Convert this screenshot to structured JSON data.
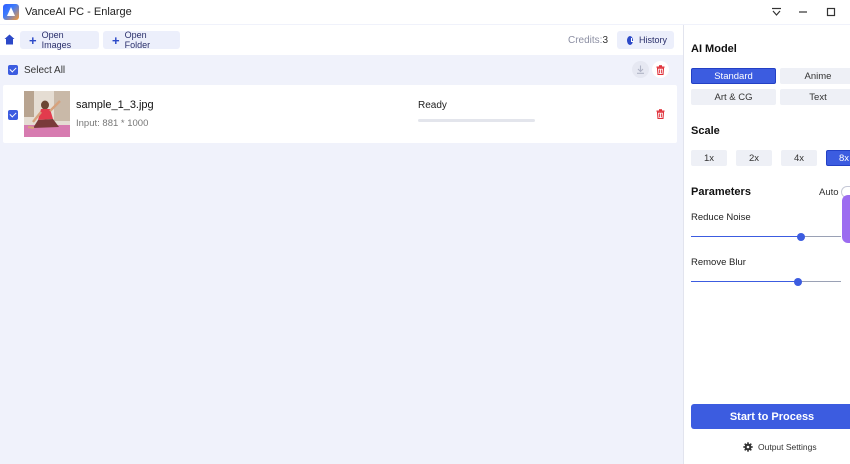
{
  "window": {
    "title": "VanceAI PC - Enlarge"
  },
  "toolbar": {
    "open_images": "Open Images",
    "open_folder": "Open Folder",
    "credits_label": "Credits:",
    "credits_value": "3",
    "history": "History"
  },
  "list": {
    "select_all": "Select All",
    "items": [
      {
        "name": "sample_1_3.jpg",
        "input": "Input: 881 * 1000",
        "status": "Ready",
        "progress": 0
      }
    ]
  },
  "panel": {
    "ai_model_heading": "AI Model",
    "models": [
      "Standard",
      "Anime",
      "Art & CG",
      "Text"
    ],
    "selected_model": "Standard",
    "scale_heading": "Scale",
    "scales": [
      "1x",
      "2x",
      "4x",
      "8x"
    ],
    "selected_scale": "8x",
    "parameters_heading": "Parameters",
    "auto_label": "Auto",
    "reduce_noise_label": "Reduce Noise",
    "reduce_noise_value": 0.73,
    "remove_blur_label": "Remove Blur",
    "remove_blur_value": 0.71,
    "process_button": "Start to Process",
    "output_settings": "Output Settings"
  },
  "colors": {
    "accent": "#3c5ce0",
    "background": "#f0f2fb",
    "delete": "#e0303a"
  },
  "icons": [
    "app-logo-icon",
    "menu-down-icon",
    "minimize-icon",
    "maximize-icon",
    "home-icon",
    "plus-icon",
    "clock-icon",
    "checkbox-icon",
    "download-icon",
    "trash-icon",
    "gear-icon"
  ]
}
